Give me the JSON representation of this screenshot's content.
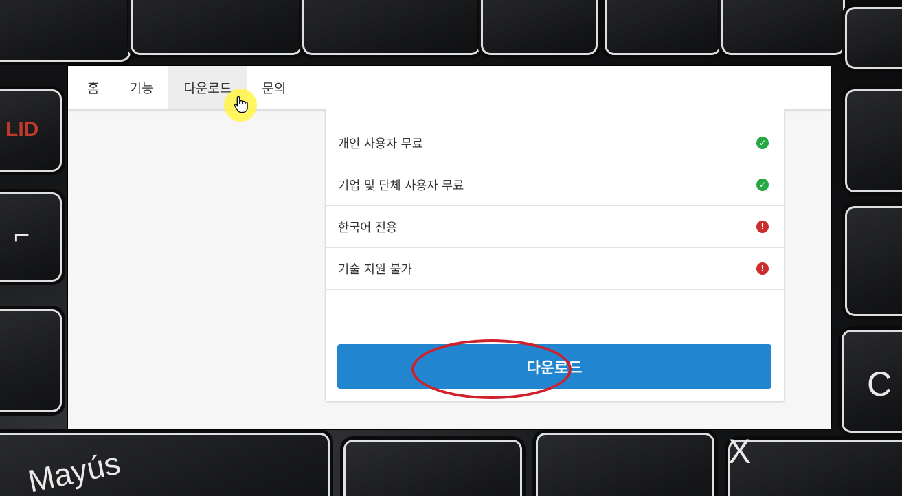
{
  "nav": {
    "items": [
      {
        "label": "홈"
      },
      {
        "label": "기능"
      },
      {
        "label": "다운로드"
      },
      {
        "label": "문의"
      }
    ],
    "active_index": 2
  },
  "features": [
    {
      "label": "개인 사용자 무료",
      "status": "ok",
      "icon": "check-circle-icon"
    },
    {
      "label": "기업 및 단체 사용자 무료",
      "status": "ok",
      "icon": "check-circle-icon"
    },
    {
      "label": "한국어 전용",
      "status": "warn",
      "icon": "exclamation-circle-icon"
    },
    {
      "label": "기술 지원 불가",
      "status": "warn",
      "icon": "exclamation-circle-icon"
    }
  ],
  "download_button": {
    "label": "다운로드"
  },
  "background_keys": {
    "mayus": "Mayús",
    "c": "C",
    "x": "X"
  },
  "colors": {
    "accent": "#2185d0",
    "ok": "#28a745",
    "warn": "#cc2e2e",
    "highlight": "#d0202a"
  }
}
